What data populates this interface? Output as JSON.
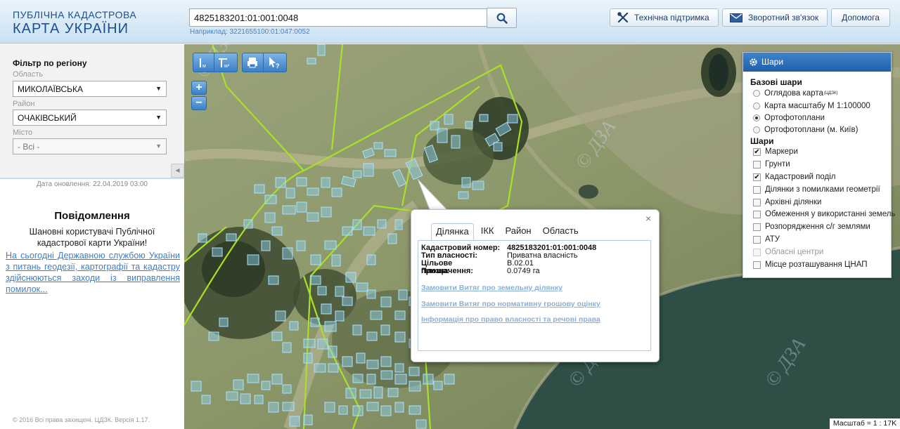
{
  "header": {
    "logo_line1": "ПУБЛІЧНА КАДАСТРОВА",
    "logo_line2": "КАРТА УКРАЇНИ",
    "search_value": "4825183201:01:001:0048",
    "search_hint": "Наприклад: 3221655100:01:047:0052",
    "support_label": "Технічна підтримка",
    "feedback_label": "Зворотний зв'язок",
    "help_label": "Допомога"
  },
  "filter": {
    "title": "Фільтр по регіону",
    "oblast_label": "Область",
    "oblast_value": "МИКОЛАЇВСЬКА",
    "rayon_label": "Район",
    "rayon_value": "ОЧАКІВСЬКИЙ",
    "city_label": "Місто",
    "city_value": "- Всі -"
  },
  "updated": "Дата оновлення: 22.04.2019 03:00",
  "notices": {
    "title": "Повідомлення",
    "greeting": "Шановні користувачі Публічної кадастрової карти України!",
    "link_text": "На сьогодні Державною службою України з питань геодезії, картографії та кадастру здійснюються заходи із виправлення помилок..."
  },
  "copyright": "© 2016 Всі права захищені. ЦДЗК. Версія 1.17.",
  "map_controls": {
    "zoom_in": "+",
    "zoom_out": "−"
  },
  "layers": {
    "title": "Шари",
    "base_title": "Базові шари",
    "base": [
      {
        "label": "Оглядова карта",
        "sup": "(ЦДЗК)",
        "selected": false
      },
      {
        "label": "Карта масштабу М 1:100000",
        "selected": false
      },
      {
        "label": "Ортофотоплани",
        "selected": true
      },
      {
        "label": "Ортофотоплани (м. Київ)",
        "selected": false
      }
    ],
    "layers_title": "Шари",
    "items": [
      {
        "label": "Маркери",
        "checked": true,
        "disabled": false
      },
      {
        "label": "Грунти",
        "checked": false,
        "disabled": false
      },
      {
        "label": "Кадастровий поділ",
        "checked": true,
        "disabled": false
      },
      {
        "label": "Ділянки з помилками геометрії",
        "checked": false,
        "disabled": false
      },
      {
        "label": "Архівні ділянки",
        "checked": false,
        "disabled": false
      },
      {
        "label": "Обмеження у використанні земель",
        "checked": false,
        "disabled": false
      },
      {
        "label": "Розпорядження с/г землями",
        "checked": false,
        "disabled": false
      },
      {
        "label": "АТУ",
        "checked": false,
        "disabled": false
      },
      {
        "label": "Обласні центри",
        "checked": false,
        "disabled": true
      },
      {
        "label": "Місце розташування ЦНАП",
        "checked": false,
        "disabled": false
      }
    ]
  },
  "popup": {
    "close": "×",
    "tabs": [
      "Ділянка",
      "ІКК",
      "Район",
      "Область"
    ],
    "rows": [
      {
        "key": "Кадастровий номер:",
        "value": "4825183201:01:001:0048",
        "bold": true
      },
      {
        "key": "Тип власності:",
        "value": "Приватна власність",
        "bold": false
      },
      {
        "key": "Цільове призначення:",
        "value": "В.02.01",
        "bold": false
      },
      {
        "key": "Площа:",
        "value": "0.0749 га",
        "bold": false
      }
    ],
    "links": [
      "Замовити Витяг про земельну ділянку",
      "Замовити Витяг про нормативну грошову оцінку",
      "Інформація про право власності та речові права"
    ]
  },
  "watermark": "© ДЗА",
  "scale": "Масштаб = 1 : 17K",
  "colors": {
    "accent": "#1f5fa8",
    "parcel": "#8fd2f2",
    "boundary": "#a8e02a",
    "water": "#2f4f46"
  }
}
